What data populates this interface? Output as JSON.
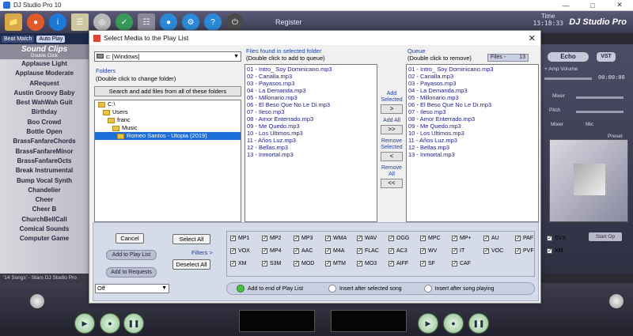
{
  "app": {
    "title": "DJ Studio Pro 10",
    "register_label": "Register",
    "time_label": "Time",
    "time_value": "13:18:33",
    "brand": "DJ Studio Pro",
    "modes": [
      "Beat Match",
      "Auto Play"
    ],
    "status_text": "'14 Songs' - Stars DJ Studio Pro"
  },
  "sound_clips": {
    "title": "Sound Clips",
    "subtitle": "Double Click",
    "items": [
      "Applause Light",
      "Applause Moderate",
      "ARequest",
      "Austin Groovy Baby",
      "Best WahWah Guit",
      "Birthday",
      "Boo Crowd",
      "Bottle Open",
      "BrassFanfareChords",
      "BrassFanfareMinor",
      "BrassFanfareOcts",
      "Break Instrumental",
      "Bump Vocal Synth",
      "Chandelier",
      "Cheer",
      "Cheer B",
      "ChurchBellCall",
      "Comical Sounds",
      "Computer Game"
    ]
  },
  "right_panel": {
    "echo_label": "Echo",
    "vst_label": "VST",
    "amp_volume_label": "+ Amp Volume",
    "time_readout": "00:00:00",
    "mixer_label": "Mixer",
    "pitch_label": "Pitch",
    "mixer_btn_label": "Mixer",
    "mic_label": "Mic",
    "preset_label": "Preset",
    "start_op_label": "Start Op"
  },
  "dialog": {
    "title": "Select Media to the Play List",
    "drive": "c: [Windows]",
    "folders_label": "Folders",
    "folders_hint": "(Double click to change folder)",
    "search_button": "Search and add files from all of these folders",
    "tree": [
      {
        "label": "C:\\",
        "indent": 0,
        "selected": false
      },
      {
        "label": "Users",
        "indent": 1,
        "selected": false
      },
      {
        "label": "franc",
        "indent": 2,
        "selected": false
      },
      {
        "label": "Music",
        "indent": 3,
        "selected": false
      },
      {
        "label": "Romeo Santos - Utopia (2019)",
        "indent": 4,
        "selected": true
      }
    ],
    "files_title": "Files found in selected folder",
    "files_hint": "(Double click to add to queue)",
    "files": [
      "01 - Intro_ Soy Dominicano.mp3",
      "02 - Canalla.mp3",
      "03 - Payasos.mp3",
      "04 - La Demanda.mp3",
      "05 - Millonario.mp3",
      "06 - El Beso Que No Le Di.mp3",
      "07 - Ileso.mp3",
      "08 - Amor Enterrado.mp3",
      "09 - Me Quedo.mp3",
      "10 - Los Ultimos.mp3",
      "11 - Años Luz.mp3",
      "12 - Bellas.mp3",
      "13 - Inmortal.mp3"
    ],
    "queue_title": "Queue",
    "queue_hint": "(Double click to remove)",
    "files_count_label": "Files -",
    "files_count_value": "13",
    "queue": [
      "01 - Intro_ Soy Dominicano.mp3",
      "02 - Canalla.mp3",
      "03 - Payasos.mp3",
      "04 - La Demanda.mp3",
      "05 - Millonario.mp3",
      "06 - El Beso Que No Le Di.mp3",
      "07 - Ileso.mp3",
      "08 - Amor Enterrado.mp3",
      "09 - Me Quedo.mp3",
      "10 - Los Ultimos.mp3",
      "11 - Años Luz.mp3",
      "12 - Bellas.mp3",
      "13 - Inmortal.mp3"
    ],
    "add_selected_label": "Add Selected",
    "add_selected_btn": ">",
    "add_all_label": "Add All",
    "add_all_btn": ">>",
    "remove_selected_label": "Remove Selected",
    "remove_selected_btn": "<",
    "remove_all_label": "Remove All",
    "remove_all_btn": "<<",
    "cancel": "Cancel",
    "add_to_playlist": "Add to Play List",
    "add_to_requests": "Add to Requests",
    "select_all": "Select All",
    "filters_link": "Filters >",
    "deselect_all": "Deselect All",
    "off_select": "Off",
    "filters": [
      [
        "MP1",
        "MP2",
        "MP3",
        "WMA",
        "WAV",
        "OGG",
        "MPC",
        "MP+",
        "AU",
        "PAF",
        "SVX"
      ],
      [
        "VOX",
        "MP4",
        "AAC",
        "M4A",
        "FLAC",
        "AC3",
        "WV",
        "IT",
        "VOC",
        "PVF",
        "XM"
      ],
      [
        "XM",
        "S3M",
        "MOD",
        "MTM",
        "MO3",
        "AIFF",
        "SF",
        "CAF"
      ]
    ],
    "radio_options": [
      "Add to end of Play List",
      "Insert after selected song",
      "Insert after song playing"
    ]
  }
}
